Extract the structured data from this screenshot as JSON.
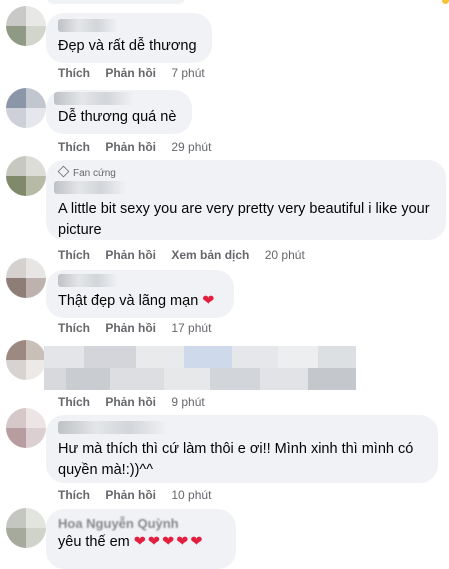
{
  "comments": [
    {
      "text": "Đẹp và rất dễ thương",
      "like": "Thích",
      "reply": "Phản hồi",
      "time": "7 phút"
    },
    {
      "text": "Dễ thương quá nè",
      "like": "Thích",
      "reply": "Phản hồi",
      "time": "29 phút"
    },
    {
      "badge": "Fan cứng",
      "text": "A little bit sexy you are very pretty very beautiful i like your picture",
      "like": "Thích",
      "reply": "Phản hồi",
      "translate": "Xem bản dịch",
      "time": "20 phút"
    },
    {
      "text": "Thật đẹp và lãng mạn",
      "emoji": "❤",
      "like": "Thích",
      "reply": "Phản hồi",
      "time": "17 phút"
    },
    {
      "like": "Thích",
      "reply": "Phản hồi",
      "time": "9 phút"
    },
    {
      "text": "Hư mà thích thì cứ làm thôi e ơi!! Mình xinh thì mình có quyền mà!:))^^",
      "like": "Thích",
      "reply": "Phản hồi",
      "time": "10 phút"
    },
    {
      "name": "Hoa Nguyễn Quỳnh",
      "text": "yêu thế em",
      "emoji": "❤❤❤❤❤"
    }
  ],
  "colors": {
    "bubble": "#f0f2f5",
    "action": "#65676b",
    "heart": "#e41e3f"
  }
}
